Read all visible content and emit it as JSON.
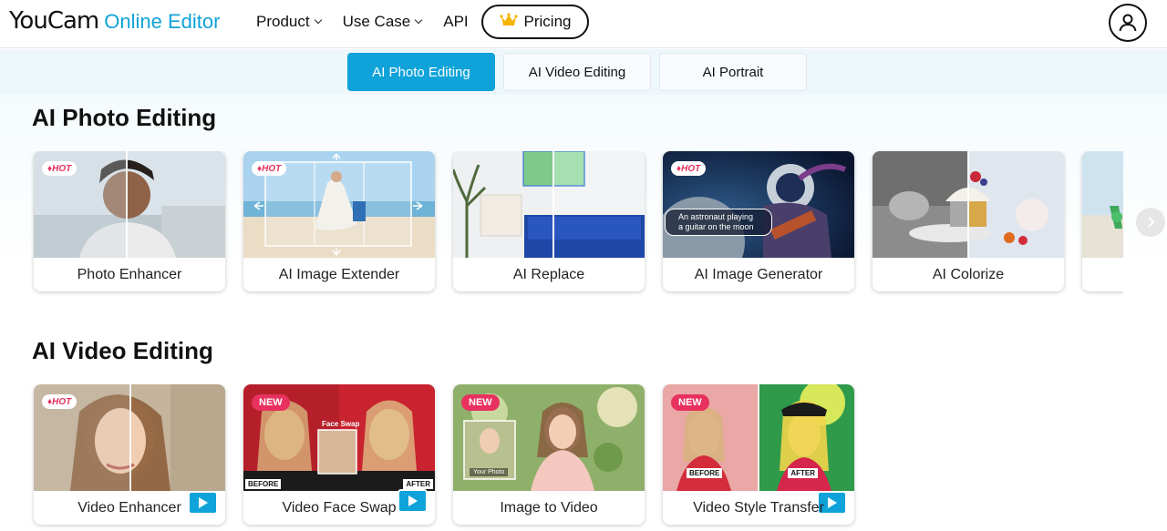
{
  "header": {
    "logo_main": "YouCam",
    "logo_sub": "Online Editor",
    "nav": [
      {
        "label": "Product",
        "has_dropdown": true
      },
      {
        "label": "Use Case",
        "has_dropdown": true
      },
      {
        "label": "API",
        "has_dropdown": false
      }
    ],
    "pricing_label": "Pricing",
    "pricing_icon": "crown-icon",
    "user_icon": "user-icon"
  },
  "tabs": [
    {
      "label": "AI Photo Editing",
      "active": true
    },
    {
      "label": "AI Video Editing",
      "active": false
    },
    {
      "label": "AI Portrait",
      "active": false
    }
  ],
  "sections": {
    "photo": {
      "title": "AI Photo Editing",
      "cards": [
        {
          "label": "Photo Enhancer",
          "badge": "HOT"
        },
        {
          "label": "AI Image Extender",
          "badge": "HOT"
        },
        {
          "label": "AI Replace",
          "badge": ""
        },
        {
          "label": "AI Image Generator",
          "badge": "HOT",
          "overlay_text": "An astronaut playing a guitar on the moon"
        },
        {
          "label": "AI Colorize",
          "badge": ""
        },
        {
          "label": "",
          "badge": ""
        }
      ]
    },
    "video": {
      "title": "AI Video Editing",
      "cards": [
        {
          "label": "Video Enhancer",
          "badge": "HOT"
        },
        {
          "label": "Video Face Swap",
          "badge": "NEW",
          "overlay_text": "Face Swap",
          "before": "BEFORE",
          "after": "AFTER"
        },
        {
          "label": "Image to Video",
          "badge": "NEW",
          "overlay_text": "Your Photo"
        },
        {
          "label": "Video Style Transfer",
          "badge": "NEW",
          "before": "BEFORE",
          "after": "AFTER"
        }
      ]
    }
  },
  "colors": {
    "accent": "#0fa3d9",
    "hot": "#e8315f"
  }
}
